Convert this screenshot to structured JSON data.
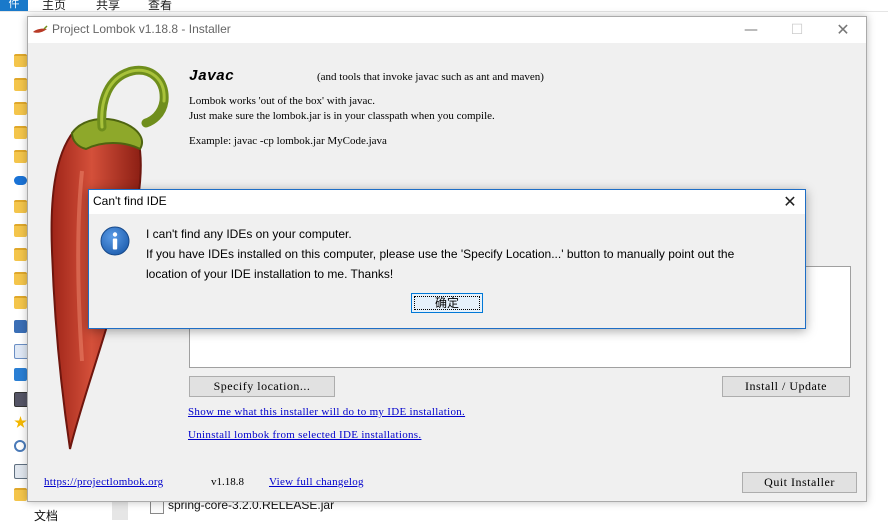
{
  "background": {
    "ribbon_tabs": [
      "件",
      "主页",
      "共享",
      "查看"
    ],
    "file_row_name": "spring-core-3.2.0.RELEASE.jar",
    "docs_label": "文档"
  },
  "window": {
    "title": "Project Lombok v1.18.8 - Installer",
    "heading": "Javac",
    "heading_note": "(and tools that invoke javac such as ant and maven)",
    "line1": "Lombok works 'out of the box' with javac.",
    "line2": "Just make sure the lombok.jar is in your classpath when you compile.",
    "line3": "Example: javac -cp lombok.jar MyCode.java",
    "specify_button": "Specify location...",
    "install_button": "Install / Update",
    "show_link": "Show me what this installer will do to my IDE installation.",
    "uninstall_link": "Uninstall lombok from selected IDE installations.",
    "site_link": "https://projectlombok.org",
    "version": "v1.18.8",
    "changelog_link": "View full changelog",
    "quit_button": "Quit Installer",
    "controls": {
      "minimize": "—",
      "maximize": "☐",
      "close": "✕"
    }
  },
  "dialog": {
    "title": "Can't find IDE",
    "icon": "info-icon",
    "message_line1": "I can't find any IDEs on your computer.",
    "message_line2": "If you have IDEs installed on this computer, please use the 'Specify Location...' button to manually point out the",
    "message_line3": "location of your IDE installation to me. Thanks!",
    "ok_button": "确定",
    "close": "✕"
  },
  "colors": {
    "link": "#0000cc",
    "dialog_border": "#1e6ec6",
    "info_icon": "#1f5fb0",
    "pepper_red": "#c0392b",
    "pepper_stem": "#7a9a1e"
  }
}
